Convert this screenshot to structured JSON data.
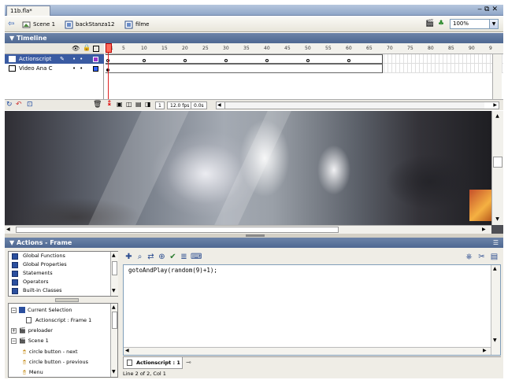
{
  "document": {
    "tab_label": "11b.fla*"
  },
  "editbar": {
    "crumbs": [
      "Scene 1",
      "backStanza12",
      "filme"
    ],
    "zoom": "100%"
  },
  "timeline": {
    "title": "Timeline",
    "layers": [
      {
        "name": "Actionscript",
        "selected": true,
        "color": "#9933cc"
      },
      {
        "name": "Video Ana C",
        "selected": false,
        "color": "#3366ff"
      }
    ],
    "ruler_numbers": [
      "1",
      "5",
      "10",
      "15",
      "20",
      "25",
      "30",
      "35",
      "40",
      "45",
      "50",
      "55",
      "60",
      "65",
      "70",
      "75",
      "80",
      "85",
      "90",
      "9"
    ],
    "status": {
      "frame": "1",
      "fps": "12.0 fps",
      "time": "0.0s"
    }
  },
  "actions": {
    "title": "Actions - Frame",
    "toolbox_items": [
      "Global Functions",
      "Global Properties",
      "Statements",
      "Operators",
      "Built-in Classes"
    ],
    "tree": [
      {
        "label": "Current Selection",
        "level": 0,
        "expander": "−"
      },
      {
        "label": "Actionscript : Frame 1",
        "level": 1,
        "expander": ""
      },
      {
        "label": "preloader",
        "level": 0,
        "expander": "+"
      },
      {
        "label": "Scene 1",
        "level": 0,
        "expander": "−"
      },
      {
        "label": "circle button - next",
        "level": 1,
        "expander": ""
      },
      {
        "label": "circle button - previous",
        "level": 1,
        "expander": ""
      },
      {
        "label": "Menu",
        "level": 1,
        "expander": ""
      }
    ],
    "code": "gotoAndPlay(random(9)+1);",
    "script_tab": "Actionscript : 1",
    "status_line": "Line 2 of 2, Col 1"
  },
  "colors": {
    "panel_header": "#56709a",
    "selection": "#3a5ba2",
    "playhead": "#e02222"
  }
}
